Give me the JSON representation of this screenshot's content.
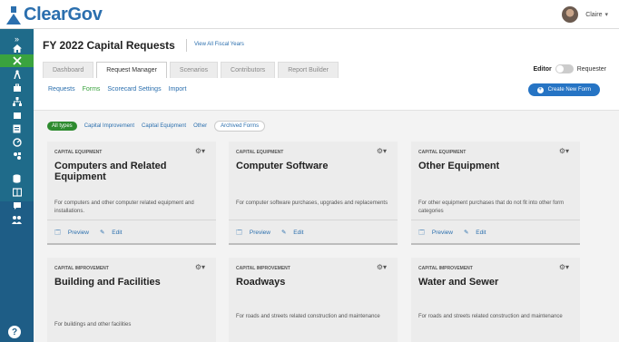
{
  "brand": {
    "name": "ClearGov"
  },
  "user": {
    "name": "Claire"
  },
  "sidebar": {
    "expand": "»",
    "help": "?"
  },
  "page": {
    "title": "FY 2022 Capital Requests",
    "view_all": "View All Fiscal Years"
  },
  "tabs": [
    "Dashboard",
    "Request Manager",
    "Scenarios",
    "Contributors",
    "Report Builder"
  ],
  "editor": {
    "label": "Editor",
    "other": "Requester"
  },
  "subnav": [
    "Requests",
    "Forms",
    "Scorecard Settings",
    "Import"
  ],
  "create_button": "Create New Form",
  "filters": [
    "All types",
    "Capital Improvement",
    "Capital Equipment",
    "Other",
    "Archived Forms"
  ],
  "cards": [
    {
      "category": "CAPITAL EQUIPMENT",
      "title": "Computers and Related Equipment",
      "description": "For computers and other computer related equipment and installations.",
      "preview": "Preview",
      "edit": "Edit"
    },
    {
      "category": "CAPITAL EQUIPMENT",
      "title": "Computer Software",
      "description": "For computer software purchases, upgrades and replacements",
      "preview": "Preview",
      "edit": "Edit"
    },
    {
      "category": "CAPITAL EQUIPMENT",
      "title": "Other Equipment",
      "description": "For other equipment purchases that do not fit into other form categories",
      "preview": "Preview",
      "edit": "Edit"
    },
    {
      "category": "CAPITAL IMPROVEMENT",
      "title": "Building and Facilities",
      "description": "For buildings and other facilities"
    },
    {
      "category": "CAPITAL IMPROVEMENT",
      "title": "Roadways",
      "description": "For roads and streets related construction and maintenance"
    },
    {
      "category": "CAPITAL IMPROVEMENT",
      "title": "Water and Sewer",
      "description": "For roads and streets related construction and maintenance"
    }
  ],
  "colors": {
    "accent_green": "#3aa33e",
    "brand_blue": "#2b6fae",
    "sidebar": "#1e5d86",
    "button": "#2674c4"
  }
}
